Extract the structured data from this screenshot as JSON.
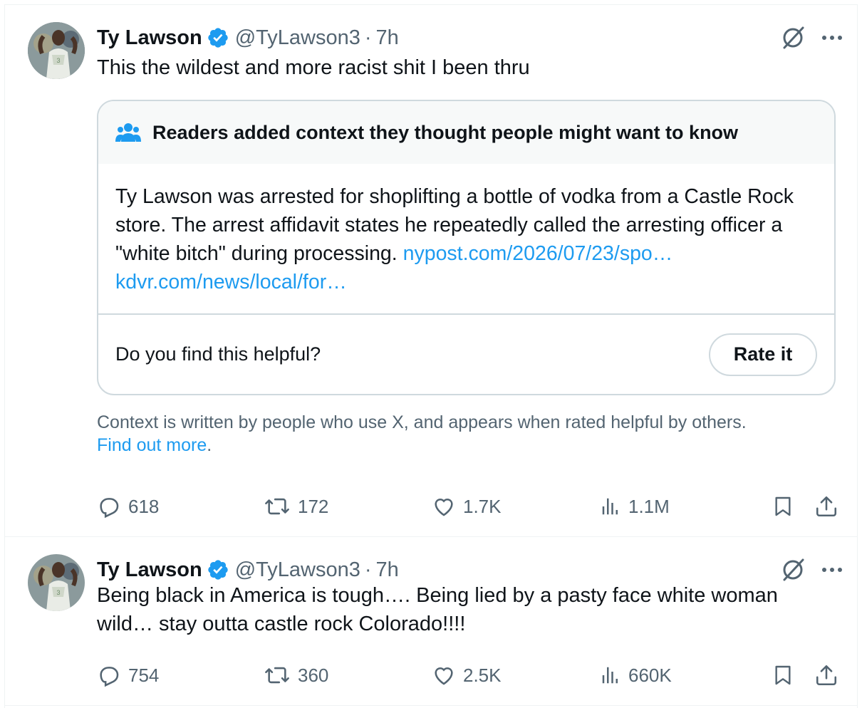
{
  "tweets": [
    {
      "author": {
        "name": "Ty Lawson",
        "handle": "@TyLawson3",
        "time": "7h"
      },
      "text": "This the wildest and more racist shit I been thru",
      "note": {
        "header": "Readers added context they thought people might want to know",
        "body": "Ty Lawson was arrested for shoplifting a bottle of vodka from a Castle Rock store. The arrest affidavit states he repeatedly called the arresting officer a \"white bitch\" during processing.",
        "link1": "nypost.com/2026/07/23/spo…",
        "link2": "kdvr.com/news/local/for…",
        "question": "Do you find this helpful?",
        "rate_label": "Rate it"
      },
      "context_text": "Context is written by people who use X, and appears when rated helpful by others.",
      "find_out_more": "Find out more",
      "stats": {
        "replies": "618",
        "retweets": "172",
        "likes": "1.7K",
        "views": "1.1M"
      }
    },
    {
      "author": {
        "name": "Ty Lawson",
        "handle": "@TyLawson3",
        "time": "7h"
      },
      "text": "Being black in America is tough…. Being lied by a pasty face white woman wild… stay outta castle rock Colorado!!!!",
      "stats": {
        "replies": "754",
        "retweets": "360",
        "likes": "2.5K",
        "views": "660K"
      }
    }
  ],
  "icons": {
    "verified": "verified-badge-icon",
    "grok": "grok-icon",
    "more": "more-icon",
    "note_people": "people-icon",
    "reply": "reply-icon",
    "retweet": "retweet-icon",
    "like": "like-icon",
    "views": "views-icon",
    "bookmark": "bookmark-icon",
    "share": "share-icon"
  },
  "colors": {
    "accent": "#1d9bf0",
    "secondary_text": "#536471",
    "border": "#cfd9de"
  }
}
